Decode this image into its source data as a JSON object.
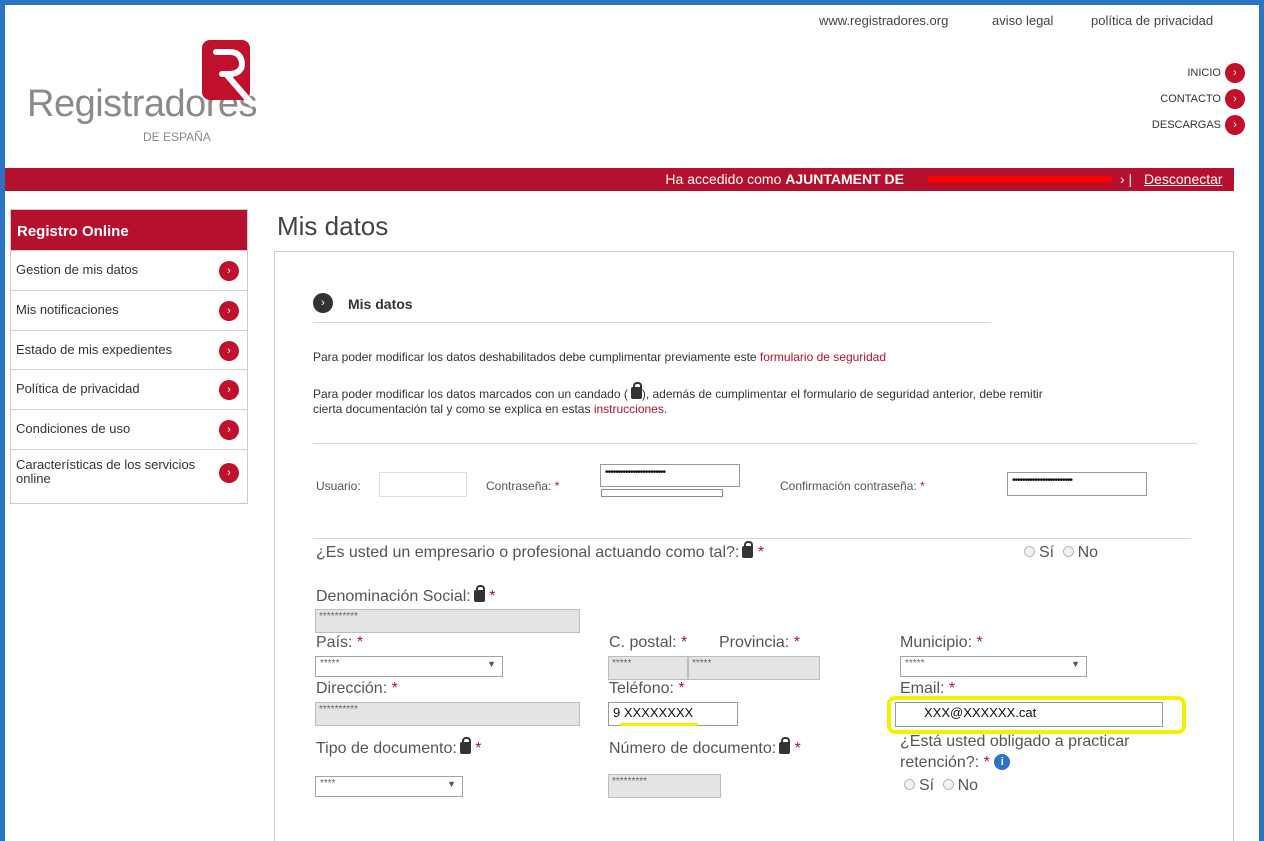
{
  "header": {
    "top_links": [
      "www.registradores.org",
      "aviso legal",
      "política de privacidad"
    ],
    "logo_text": "Registradores",
    "logo_sub": "DE ESPAÑA",
    "nav": [
      "INICIO",
      "CONTACTO",
      "DESCARGAS"
    ]
  },
  "userbar": {
    "prefix": "Ha accedido como ",
    "user": "AJUNTAMENT DE",
    "separator": "› |",
    "logout": "Desconectar"
  },
  "sidebar": {
    "title": "Registro Online",
    "items": [
      "Gestion de mis datos",
      "Mis notificaciones",
      "Estado de mis expedientes",
      "Política de privacidad",
      "Condiciones de uso",
      "Características de los servicios online"
    ]
  },
  "main": {
    "page_title": "Mis datos",
    "section_title": "Mis datos",
    "info1_text": "Para poder modificar los datos deshabilitados debe cumplimentar previamente este ",
    "info1_link": "formulario de seguridad",
    "info2_line1": "Para poder modificar los datos marcados con un candado (",
    "info2_line1b": "), además de cumplimentar el formulario de seguridad anterior, debe remitir",
    "info2_line2": "cierta documentación tal y como se explica en estas ",
    "info2_link": "instrucciones",
    "info2_end": "."
  },
  "form": {
    "usuario_label": "Usuario:",
    "password_label": "Contraseña:",
    "password_value": "••••••••••••••••••••••••",
    "confirm_label": "Confirmación contraseña:",
    "confirm_value": "••••••••••••••••••••••••",
    "required": "*",
    "empresario_question": "¿Es usted un empresario o profesional actuando como tal?:",
    "yes": "Sí",
    "no": "No",
    "denominacion_label": "Denominación Social:",
    "denominacion_value": "**********",
    "pais_label": "País:",
    "pais_value": "*****",
    "cpostal_label": "C. postal:",
    "cpostal_value": "*****",
    "provincia_label": "Provincia:",
    "provincia_value": "*****",
    "municipio_label": "Municipio:",
    "municipio_value": "*****",
    "direccion_label": "Dirección:",
    "direccion_value": "**********",
    "telefono_label": "Teléfono:",
    "telefono_value": "9 XXXXXXXX",
    "email_label": "Email:",
    "email_value": "XXX@XXXXXX.cat",
    "tipo_doc_label": "Tipo de documento:",
    "tipo_doc_value": "****",
    "numero_doc_label": "Número de documento:",
    "numero_doc_value": "*********",
    "retencion_label_1": "¿Está usted obligado a practicar",
    "retencion_label_2": "retención?:"
  },
  "colors": {
    "brand_red": "#b5112e",
    "frame_blue": "#2b73c3",
    "highlight_yellow": "#f5ef00"
  }
}
